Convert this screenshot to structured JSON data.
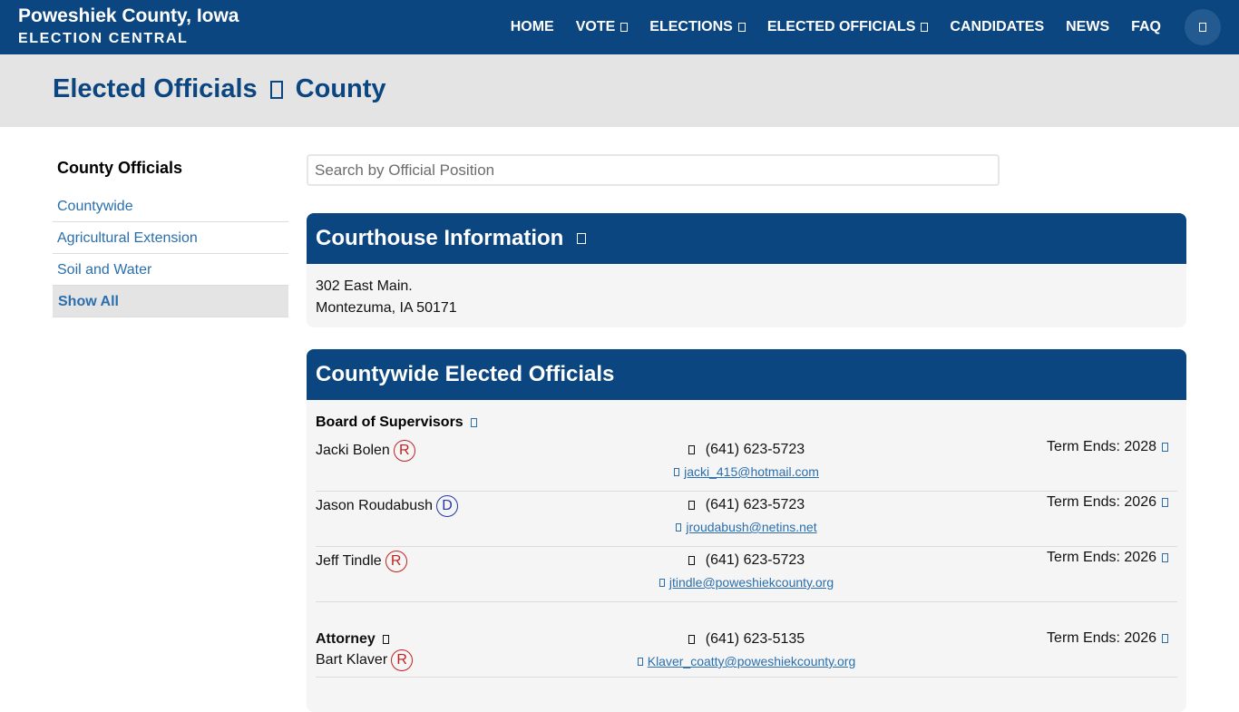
{
  "site": {
    "title": "Poweshiek County, Iowa",
    "subtitle": "ELECTION CENTRAL"
  },
  "nav": {
    "items": [
      {
        "label": "HOME",
        "dropdown": false
      },
      {
        "label": "VOTE",
        "dropdown": true
      },
      {
        "label": "ELECTIONS",
        "dropdown": true
      },
      {
        "label": "ELECTED OFFICIALS",
        "dropdown": true
      },
      {
        "label": "CANDIDATES",
        "dropdown": false
      },
      {
        "label": "NEWS",
        "dropdown": false
      },
      {
        "label": "FAQ",
        "dropdown": false
      }
    ],
    "search_icon": "search-icon"
  },
  "page": {
    "title_part1": "Elected Officials",
    "title_part2": "County"
  },
  "sidebar": {
    "heading": "County Officials",
    "items": [
      {
        "label": "Countywide",
        "active": false
      },
      {
        "label": "Agricultural Extension",
        "active": false
      },
      {
        "label": "Soil and Water",
        "active": false
      },
      {
        "label": "Show All",
        "active": true
      }
    ]
  },
  "search": {
    "placeholder": "Search by Official Position",
    "value": ""
  },
  "courthouse": {
    "heading": "Courthouse Information",
    "address_line1": "302 East Main.",
    "address_line2": "Montezuma, IA 50171"
  },
  "countywide": {
    "heading": "Countywide Elected Officials",
    "board_title": "Board of Supervisors",
    "board": [
      {
        "name": "Jacki Bolen",
        "party": "R",
        "phone": "(641) 623-5723",
        "email": "jacki_415@hotmail.com",
        "term": "Term Ends: 2028"
      },
      {
        "name": "Jason Roudabush",
        "party": "D",
        "phone": "(641) 623-5723",
        "email": "jroudabush@netins.net",
        "term": "Term Ends: 2026"
      },
      {
        "name": "Jeff Tindle",
        "party": "R",
        "phone": "(641) 623-5723",
        "email": "jtindle@poweshiekcounty.org",
        "term": "Term Ends: 2026"
      }
    ],
    "attorney": {
      "title": "Attorney",
      "name": "Bart Klaver",
      "party": "R",
      "phone": "(641) 623-5135",
      "email": "Klaver_coatty@poweshiekcounty.org",
      "term": "Term Ends: 2026"
    }
  },
  "colors": {
    "brand": "#0b4680",
    "link": "#2a6fad",
    "republican": "#c32020",
    "democrat": "#2436a8"
  }
}
